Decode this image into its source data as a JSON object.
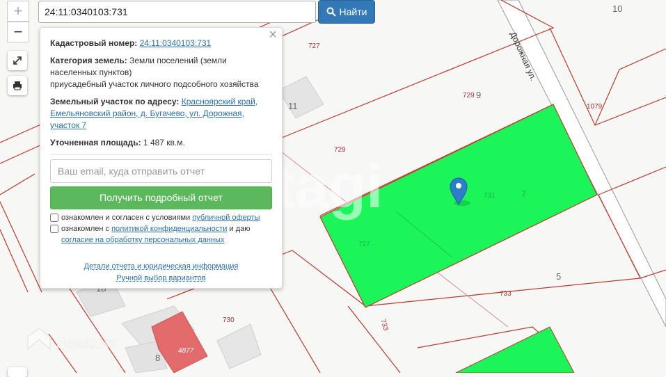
{
  "map": {
    "house_numbers": [
      "10",
      "9",
      "11",
      "5",
      "7",
      "8",
      "18"
    ],
    "parcel_numbers": [
      "727",
      "729",
      "729",
      "1079",
      "733",
      "733",
      "730",
      "4877",
      "731",
      "727"
    ],
    "street_label": "Дорожная ул.",
    "watermark": "etagi",
    "domclick_label": "Домклик"
  },
  "controls": {
    "zoom_in": "+",
    "zoom_out": "−"
  },
  "search": {
    "value": "24:11:0340103:731",
    "button_label": "Найти"
  },
  "popup": {
    "close": "×",
    "cadastral_label": "Кадастровый номер:",
    "cadastral_value": "24:11:0340103:731",
    "category_label": "Категория земель:",
    "category_value": "Земли поселений (земли населенных пунктов)",
    "category_use": "приусадебный участок личного подсобного хозяйства",
    "address_label": "Земельный участок по адресу:",
    "address_value": "Красноярский край, Емельяновский район, д. Бугачево, ул. Дорожная, участок 7",
    "area_label": "Уточненная площадь:",
    "area_value": "1 487 кв.м.",
    "email_placeholder": "Ваш email, куда отправить отчет",
    "report_button": "Получить подробный отчет",
    "consent1_text": "ознакомлен и согласен с условиями",
    "consent1_link": "публичной оферты",
    "consent2_text": "ознакомлен с",
    "consent2_link": "политикой конфиденциальности",
    "consent2_mid": "и даю",
    "consent2_link2": "согласие на обработку персональных данных",
    "details_link": "Детали отчета и юридическая информация",
    "manual_link": "Ручной выбор вариантов"
  },
  "colors": {
    "selected_parcel": "#1cf55a",
    "parcel_border": "#c0392b",
    "building": "#e36b6b"
  }
}
